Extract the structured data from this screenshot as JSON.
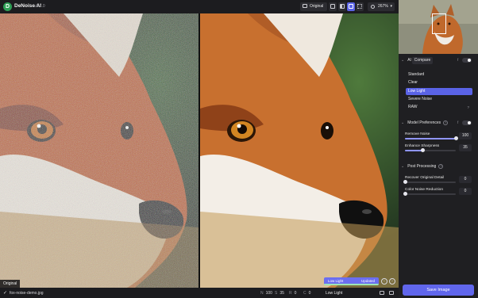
{
  "app": {
    "title": "DeNoise AI",
    "version": "v3.7.0",
    "logo_letter": "D"
  },
  "toolbar": {
    "original_label": "Original",
    "view_modes": [
      "single-view",
      "split-view",
      "side-by-side",
      "quad-view"
    ],
    "active_view": "side-by-side",
    "zoom": "267%"
  },
  "preview": {
    "original_tag": "Original",
    "model_strip": {
      "model": "Low Light",
      "status": "Updated",
      "progress": 1.0
    }
  },
  "bottombar": {
    "filename": "fox-noise-demo.jpg",
    "stats": [
      {
        "key": "N",
        "value": "100"
      },
      {
        "key": "S",
        "value": "35"
      },
      {
        "key": "R",
        "value": "0"
      },
      {
        "key": "C",
        "value": "0"
      }
    ],
    "model": "Low Light"
  },
  "panel": {
    "ai_model": {
      "heading": "AI Model",
      "compare_label": "Compare",
      "compare_info": "f",
      "models": [
        {
          "label": "Standard",
          "active": false
        },
        {
          "label": "Clear",
          "active": false
        },
        {
          "label": "Low Light",
          "active": true
        },
        {
          "label": "Severe Noise",
          "active": false
        },
        {
          "label": "RAW",
          "active": false,
          "indicator": "?"
        }
      ]
    },
    "model_preferences": {
      "heading": "Model Preferences",
      "info": "f",
      "params": [
        {
          "label": "Remove Noise",
          "value": "100",
          "fraction": 1.0
        },
        {
          "label": "Enhance Sharpness",
          "value": "35",
          "fraction": 0.35
        }
      ]
    },
    "post_processing": {
      "heading": "Post Processing",
      "params": [
        {
          "label": "Recover Original Detail",
          "value": "0",
          "fraction": 0.0
        },
        {
          "label": "Color Noise Reduction",
          "value": "0",
          "fraction": 0.0
        }
      ]
    },
    "save_label": "Save Image"
  },
  "colors": {
    "accent": "#5a63e6",
    "panel": "#1f1f22",
    "success": "#9fe6b5"
  },
  "icons": [
    "check-icon",
    "help-icon",
    "chevron-down-icon",
    "magnifier-icon",
    "camera-icon",
    "trash-icon"
  ]
}
